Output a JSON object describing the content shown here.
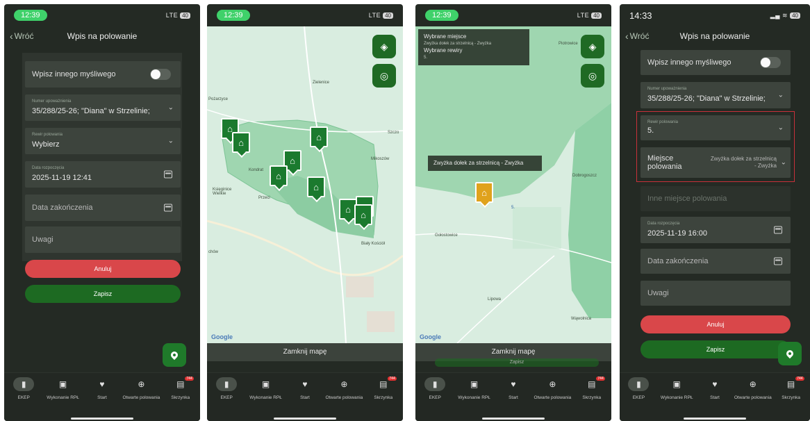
{
  "screen1": {
    "status": {
      "time": "12:39",
      "signal": "LTE",
      "battery": "40"
    },
    "nav": {
      "back": "Wróć",
      "title": "Wpis na polowanie"
    },
    "toggle_label": "Wpisz innego myśliwego",
    "authorization": {
      "label": "Numer upoważnienia",
      "value": "35/288/25-26; \"Diana\" w Strzelinie;"
    },
    "district": {
      "label": "Rewir polowania",
      "value": "Wybierz"
    },
    "start": {
      "label": "Data rozpoczęcia",
      "value": "2025-11-19 12:41"
    },
    "end_placeholder": "Data zakończenia",
    "notes_placeholder": "Uwagi",
    "cancel": "Anuluj",
    "save": "Zapisz"
  },
  "screen2": {
    "status": {
      "time": "12:39",
      "signal": "LTE",
      "battery": "40"
    },
    "labels": {
      "l1": "Zielenice",
      "l2": "Pożarzyce",
      "l3": "Księginice Wielkie",
      "l4": "Przeci",
      "l5": "Kondrat",
      "l6": "Mikoszów",
      "l7": "Szczo",
      "l8": "Biały Kościół",
      "l9": "chów"
    },
    "close_map": "Zamknij mapę",
    "google": "Google"
  },
  "screen3": {
    "status": {
      "time": "12:39",
      "signal": "LTE",
      "battery": "40"
    },
    "info": {
      "title": "Wybrane miejsce",
      "place": "Zwyżka dołek za strzelnicą - Zwyżka",
      "districts_title": "Wybrane rewiry",
      "districts": "5."
    },
    "callout": "Zwyżka dołek za strzelnicą - Zwyżka",
    "labels": {
      "l1": "Piotrowice",
      "l2": "Dobrogoszcz",
      "l3": "Gołostowice",
      "l4": "Lipowa",
      "l5": "Wąwolnica",
      "l6": "5."
    },
    "close_map": "Zamknij mapę",
    "save": "Zapisz",
    "google": "Google"
  },
  "screen4": {
    "status": {
      "time": "14:33",
      "signal": "",
      "battery": "40"
    },
    "nav": {
      "back": "Wróć",
      "title": "Wpis na polowanie"
    },
    "toggle_label": "Wpisz innego myśliwego",
    "authorization": {
      "label": "Numer upoważnienia",
      "value": "35/288/25-26; \"Diana\" w Strzelinie;"
    },
    "district": {
      "label": "Rewir polowania",
      "value": "5."
    },
    "place": {
      "label": "Miejsce polowania",
      "value": "Zwyżka dołek za strzelnicą - Zwyżka"
    },
    "other_place_placeholder": "Inne miejsce polowania",
    "start": {
      "label": "Data rozpoczęcia",
      "value": "2025-11-19 16:00"
    },
    "end_placeholder": "Data zakończenia",
    "notes_placeholder": "Uwagi",
    "cancel": "Anuluj",
    "save": "Zapisz"
  },
  "tabs": [
    {
      "label": "EKEP",
      "icon": "book-icon"
    },
    {
      "label": "Wykonanie RPŁ",
      "icon": "calendar-icon"
    },
    {
      "label": "Start",
      "icon": "deer-icon"
    },
    {
      "label": "Otwarte polowania",
      "icon": "target-icon"
    },
    {
      "label": "Skrzynka",
      "icon": "inbox-icon",
      "badge": "744"
    }
  ],
  "colors": {
    "accent_green": "#1f7a2a",
    "cancel_red": "#d9474a",
    "selected_stand": "#e0a21c"
  }
}
